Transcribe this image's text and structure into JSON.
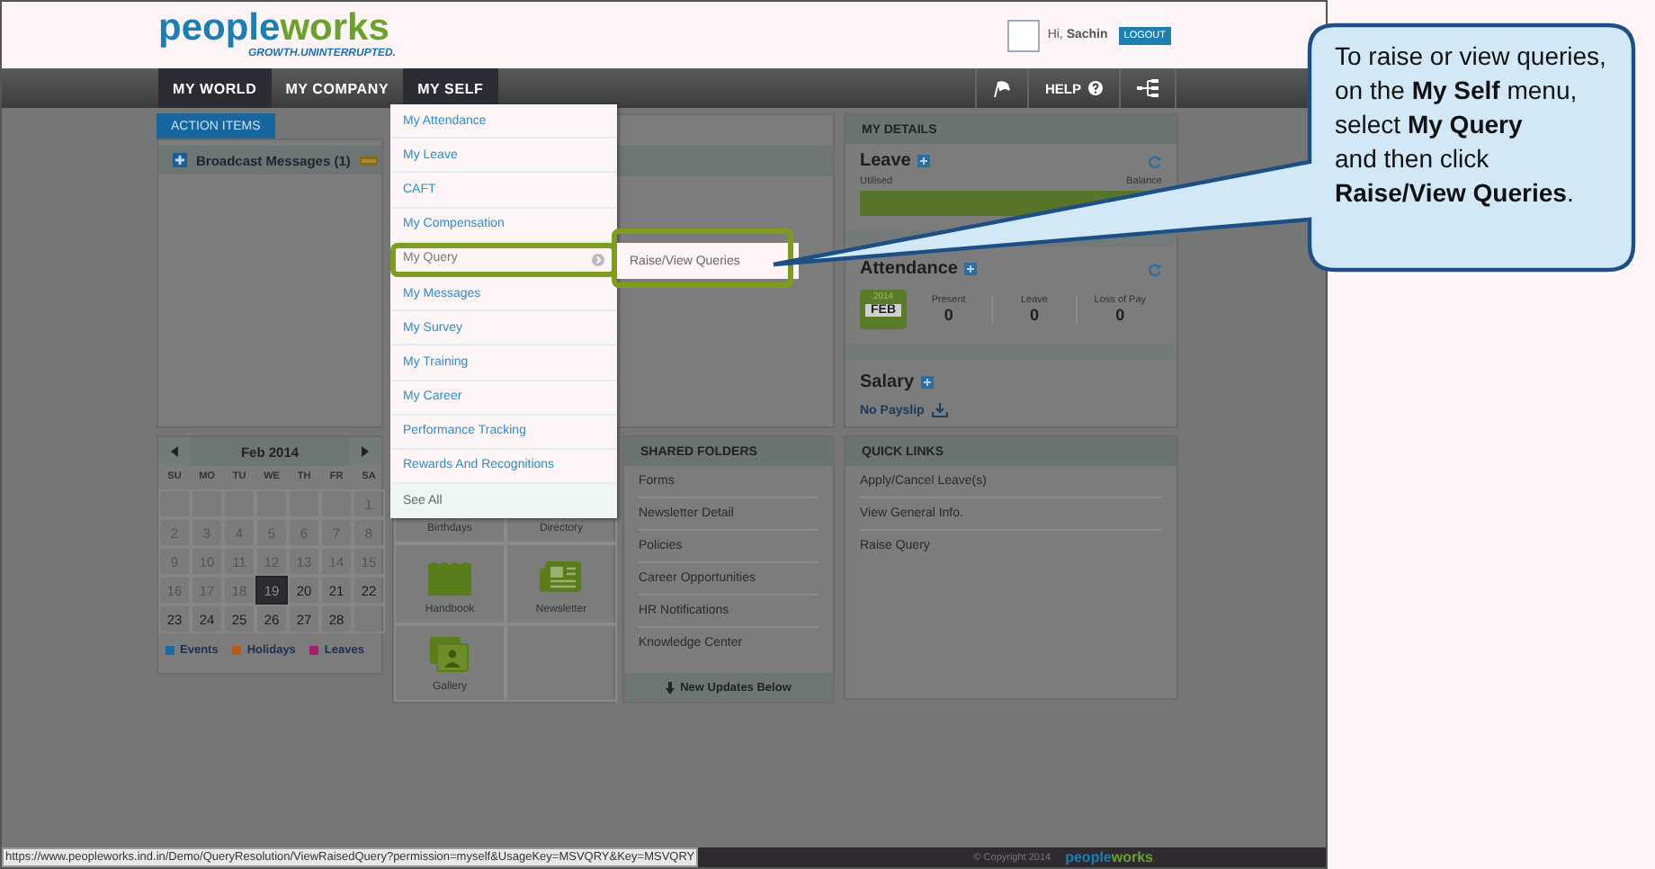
{
  "header": {
    "logo_first": "people",
    "logo_second": "works",
    "tagline": "GROWTH.UNINTERRUPTED.",
    "greeting": "Hi, **Sachin**",
    "logout": "LOGOUT"
  },
  "nav": {
    "tabs": [
      {
        "label": "MY WORLD",
        "selected": true,
        "open": false
      },
      {
        "label": "MY COMPANY",
        "selected": false,
        "open": false
      },
      {
        "label": "MY SELF",
        "selected": false,
        "open": true
      }
    ],
    "help": "HELP"
  },
  "action_items": {
    "tab": "ACTION ITEMS",
    "broadcast": "Broadcast Messages (1)"
  },
  "calendar": {
    "title": "Feb 2014",
    "weekdays": [
      "SU",
      "MO",
      "TU",
      "WE",
      "TH",
      "FR",
      "SA"
    ],
    "weeks": [
      [
        {
          "kind": "blank"
        },
        {
          "kind": "blank"
        },
        {
          "kind": "blank"
        },
        {
          "kind": "blank"
        },
        {
          "kind": "blank"
        },
        {
          "kind": "blank"
        },
        {
          "kind": "date",
          "day": "1",
          "past": true,
          "selected": false
        }
      ],
      [
        {
          "kind": "date",
          "day": "2",
          "past": true,
          "selected": false
        },
        {
          "kind": "date",
          "day": "3",
          "past": true,
          "selected": false
        },
        {
          "kind": "date",
          "day": "4",
          "past": true,
          "selected": false
        },
        {
          "kind": "date",
          "day": "5",
          "past": true,
          "selected": false
        },
        {
          "kind": "date",
          "day": "6",
          "past": true,
          "selected": false
        },
        {
          "kind": "date",
          "day": "7",
          "past": true,
          "selected": false
        },
        {
          "kind": "date",
          "day": "8",
          "past": true,
          "selected": false
        }
      ],
      [
        {
          "kind": "date",
          "day": "9",
          "past": true,
          "selected": false
        },
        {
          "kind": "date",
          "day": "10",
          "past": true,
          "selected": false
        },
        {
          "kind": "date",
          "day": "11",
          "past": true,
          "selected": false
        },
        {
          "kind": "date",
          "day": "12",
          "past": true,
          "selected": false
        },
        {
          "kind": "date",
          "day": "13",
          "past": true,
          "selected": false
        },
        {
          "kind": "date",
          "day": "14",
          "past": true,
          "selected": false
        },
        {
          "kind": "date",
          "day": "15",
          "past": true,
          "selected": false
        }
      ],
      [
        {
          "kind": "date",
          "day": "16",
          "past": true,
          "selected": false
        },
        {
          "kind": "date",
          "day": "17",
          "past": true,
          "selected": false
        },
        {
          "kind": "date",
          "day": "18",
          "past": true,
          "selected": false
        },
        {
          "kind": "date",
          "day": "19",
          "past": false,
          "selected": true
        },
        {
          "kind": "date",
          "day": "20",
          "past": false,
          "selected": false
        },
        {
          "kind": "date",
          "day": "21",
          "past": false,
          "selected": false
        },
        {
          "kind": "date",
          "day": "22",
          "past": false,
          "selected": false
        }
      ],
      [
        {
          "kind": "date",
          "day": "23",
          "past": false,
          "selected": false
        },
        {
          "kind": "date",
          "day": "24",
          "past": false,
          "selected": false
        },
        {
          "kind": "date",
          "day": "25",
          "past": false,
          "selected": false
        },
        {
          "kind": "date",
          "day": "26",
          "past": false,
          "selected": false
        },
        {
          "kind": "date",
          "day": "27",
          "past": false,
          "selected": false
        },
        {
          "kind": "date",
          "day": "28",
          "past": false,
          "selected": false
        },
        {
          "kind": "blank"
        }
      ]
    ],
    "legend": [
      {
        "label": "Events",
        "color": "#1a6aa8"
      },
      {
        "label": "Holidays",
        "color": "#b85a18"
      },
      {
        "label": "Leaves",
        "color": "#a41f72"
      }
    ]
  },
  "tiles": [
    {
      "label": "Birthdays",
      "kind": "plain"
    },
    {
      "label": "Directory",
      "kind": "plain"
    },
    {
      "label": "Handbook",
      "kind": "book"
    },
    {
      "label": "Newsletter",
      "kind": "newspaper"
    },
    {
      "label": "Gallery",
      "kind": "photo"
    }
  ],
  "shared_folders": {
    "title": "SHARED FOLDERS",
    "items": [
      "Forms",
      "Newsletter Detail",
      "Policies",
      "Career Opportunities",
      "HR Notifications",
      "Knowledge Center"
    ],
    "footer": "New Updates Below"
  },
  "quick_links": {
    "title": "QUICK LINKS",
    "items": [
      "Apply/Cancel Leave(s)",
      "View General Info.",
      "Raise Query"
    ]
  },
  "my_details": {
    "title": "MY DETAILS",
    "leave": {
      "title": "Leave",
      "utilised": "Utilised",
      "balance": "Balance",
      "level": 1
    },
    "attendance": {
      "title": "Attendance",
      "year": "2014",
      "month": "FEB",
      "stats": [
        {
          "label": "Present",
          "value": "0"
        },
        {
          "label": "Leave",
          "value": "0"
        },
        {
          "label": "Loss of Pay",
          "value": "0"
        }
      ]
    },
    "salary": {
      "title": "Salary",
      "payslip": "No Payslip"
    }
  },
  "menu": {
    "items": [
      {
        "label": "My Attendance",
        "kind": "item",
        "active": false,
        "has_submenu": false,
        "highlighted": false
      },
      {
        "label": "My Leave",
        "kind": "item",
        "active": false,
        "has_submenu": false,
        "highlighted": false
      },
      {
        "label": "CAFT",
        "kind": "item",
        "active": false,
        "has_submenu": false,
        "highlighted": false
      },
      {
        "label": "My Compensation",
        "kind": "item",
        "active": false,
        "has_submenu": false,
        "highlighted": false
      },
      {
        "label": "My Query",
        "kind": "item",
        "active": true,
        "has_submenu": true,
        "highlighted": true
      },
      {
        "label": "My Messages",
        "kind": "item",
        "active": false,
        "has_submenu": false,
        "highlighted": false
      },
      {
        "label": "My Survey",
        "kind": "item",
        "active": false,
        "has_submenu": false,
        "highlighted": false
      },
      {
        "label": "My Training",
        "kind": "item",
        "active": false,
        "has_submenu": false,
        "highlighted": false
      },
      {
        "label": "My Career",
        "kind": "item",
        "active": false,
        "has_submenu": false,
        "highlighted": false
      },
      {
        "label": "Performance Tracking",
        "kind": "item",
        "active": false,
        "has_submenu": false,
        "highlighted": false
      },
      {
        "label": "Rewards And Recognitions",
        "kind": "item",
        "active": false,
        "has_submenu": false,
        "highlighted": false
      },
      {
        "label": "See All",
        "kind": "see_all",
        "active": false,
        "has_submenu": false,
        "highlighted": false
      }
    ],
    "submenu": [
      {
        "label": "Raise/View Queries",
        "highlighted": true
      }
    ]
  },
  "footer": {
    "status_url": "https://www.peopleworks.ind.in/Demo/QueryResolution/ViewRaisedQuery?permission=myself&UsageKey=MSVQRY&Key=MSVQRY",
    "copyright": "© Copyright 2014",
    "logo_first": "people",
    "logo_second": "works"
  },
  "callout": {
    "text": "To raise or view queries,\non the **My Self** menu,\nselect **My Query**\nand then click\n**Raise/View Queries**."
  }
}
